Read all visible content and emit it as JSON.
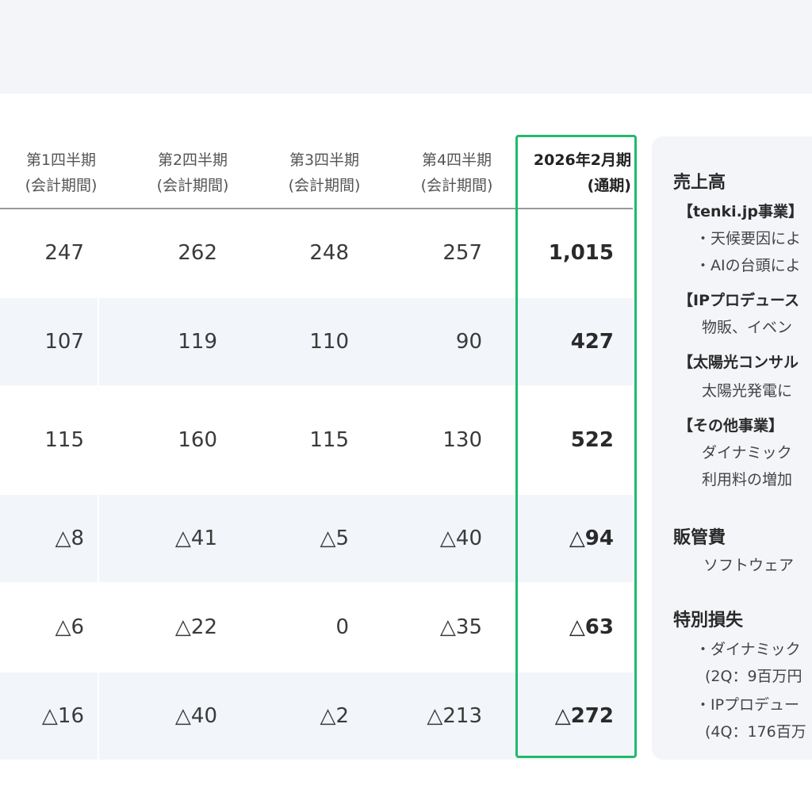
{
  "table": {
    "columns": [
      {
        "line1": "第1四半期",
        "line2": "(会計期間)"
      },
      {
        "line1": "第2四半期",
        "line2": "(会計期間)"
      },
      {
        "line1": "第3四半期",
        "line2": "(会計期間)"
      },
      {
        "line1": "第4四半期",
        "line2": "(会計期間)"
      },
      {
        "line1": "2026年2月期",
        "line2": "(通期)"
      }
    ],
    "rows": [
      [
        "247",
        "262",
        "248",
        "257",
        "1,015"
      ],
      [
        "107",
        "119",
        "110",
        "90",
        "427"
      ],
      [
        "115",
        "160",
        "115",
        "130",
        "522"
      ],
      [
        "△8",
        "△41",
        "△5",
        "△40",
        "△94"
      ],
      [
        "△6",
        "△22",
        "0",
        "△35",
        "△63"
      ],
      [
        "△16",
        "△40",
        "△2",
        "△213",
        "△272"
      ]
    ]
  },
  "notes": {
    "sales_heading": "売上高",
    "tenki_heading": "【tenki.jp事業】",
    "tenki_line1": "・天候要因によ",
    "tenki_line2": "・AIの台頭によ",
    "ip_heading": "【IPプロデュース",
    "ip_line1": "物販、イベン",
    "solar_heading": "【太陽光コンサル",
    "solar_line1": "太陽光発電に",
    "other_heading": "【その他事業】",
    "other_line1": "ダイナミック",
    "other_line2": "利用料の増加",
    "sga_heading": "販管費",
    "sga_line1": "ソフトウェア",
    "loss_heading": "特別損失",
    "loss_line1": "・ダイナミック",
    "loss_line2": "(2Q：9百万円",
    "loss_line3": "・IPプロデュー",
    "loss_line4": "(4Q：176百万"
  },
  "colors": {
    "highlight": "#1fba6b",
    "row_shade": "#f2f5fa",
    "band": "#f3f5f9"
  }
}
